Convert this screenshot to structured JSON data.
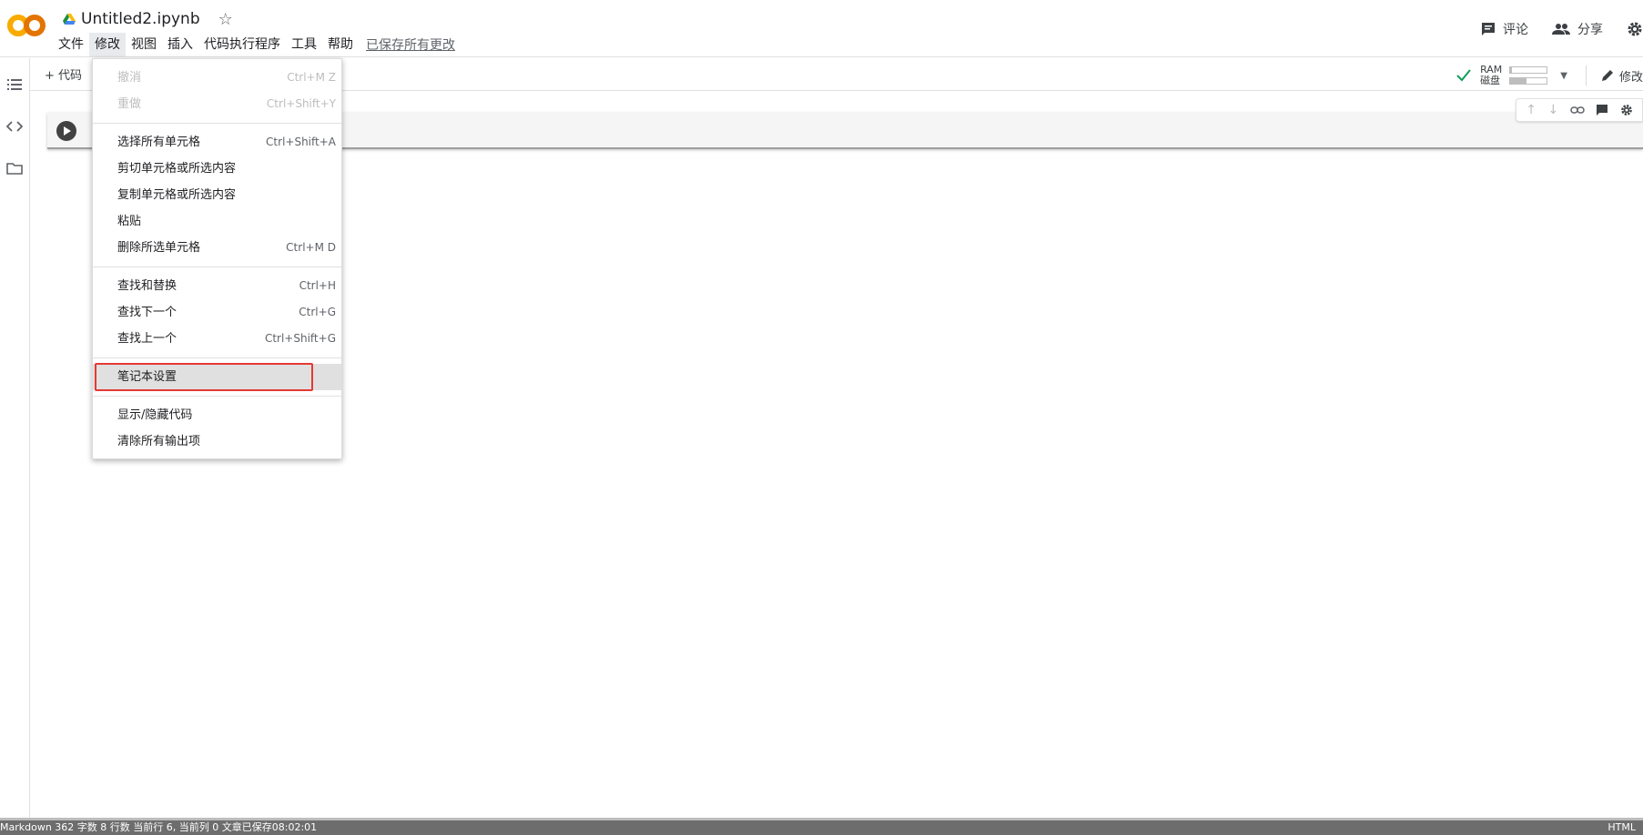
{
  "app": {
    "logo_text": "CO",
    "file_name": "Untitled2.ipynb"
  },
  "menubar": {
    "items": [
      "文件",
      "修改",
      "视图",
      "插入",
      "代码执行程序",
      "工具",
      "帮助"
    ],
    "saved_status": "已保存所有更改"
  },
  "header_right": {
    "comment_label": "评论",
    "share_label": "分享"
  },
  "toolbar": {
    "add_code_label": "+ 代码",
    "ram_label": "RAM",
    "disk_label": "磁盘",
    "ram_fill": 0.05,
    "disk_fill": 0.45,
    "edit_label": "修改"
  },
  "edit_menu": {
    "groups": [
      [
        {
          "label": "撤消",
          "shortcut": "Ctrl+M Z",
          "disabled": true
        },
        {
          "label": "重做",
          "shortcut": "Ctrl+Shift+Y",
          "disabled": true
        }
      ],
      [
        {
          "label": "选择所有单元格",
          "shortcut": "Ctrl+Shift+A"
        },
        {
          "label": "剪切单元格或所选内容",
          "shortcut": ""
        },
        {
          "label": "复制单元格或所选内容",
          "shortcut": ""
        },
        {
          "label": "粘贴",
          "shortcut": ""
        },
        {
          "label": "删除所选单元格",
          "shortcut": "Ctrl+M D"
        }
      ],
      [
        {
          "label": "查找和替换",
          "shortcut": "Ctrl+H"
        },
        {
          "label": "查找下一个",
          "shortcut": "Ctrl+G"
        },
        {
          "label": "查找上一个",
          "shortcut": "Ctrl+Shift+G"
        }
      ],
      [
        {
          "label": "笔记本设置",
          "shortcut": "",
          "highlighted": true
        }
      ],
      [
        {
          "label": "显示/隐藏代码",
          "shortcut": ""
        },
        {
          "label": "清除所有输出项",
          "shortcut": ""
        }
      ]
    ]
  },
  "statusbar": {
    "left_text": "Markdown   362 字数   8 行数   当前行 6, 当前列 0   文章已保存08:02:01",
    "right_text": "HTML"
  },
  "colors": {
    "logo_orange": "#F9AB00",
    "logo_dark": "#E37400",
    "check_green": "#0F9D58",
    "highlight_red": "#E53935"
  }
}
